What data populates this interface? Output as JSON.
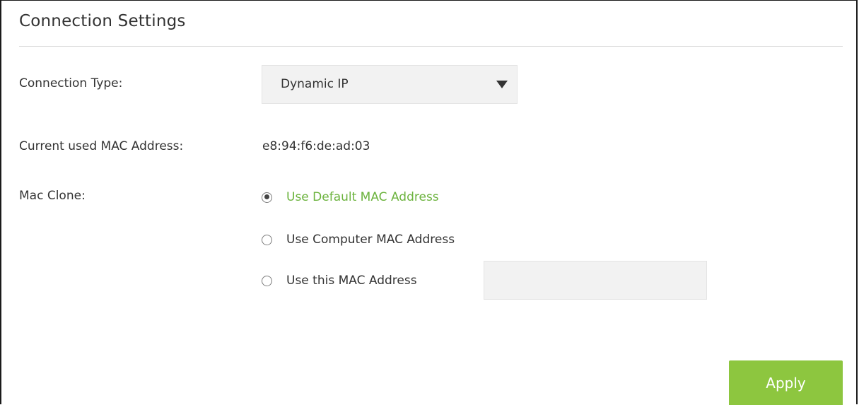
{
  "section": {
    "title": "Connection Settings"
  },
  "connection_type": {
    "label": "Connection Type:",
    "selected": "Dynamic IP"
  },
  "current_mac": {
    "label": "Current used MAC Address:",
    "value": "e8:94:f6:de:ad:03"
  },
  "mac_clone": {
    "label": "Mac Clone:",
    "options": [
      {
        "label": "Use Default MAC Address",
        "checked": true
      },
      {
        "label": "Use Computer MAC Address",
        "checked": false
      },
      {
        "label": "Use this MAC Address",
        "checked": false
      }
    ],
    "custom_mac_value": ""
  },
  "actions": {
    "apply_label": "Apply"
  },
  "colors": {
    "accent": "#8dc63f",
    "selected_text": "#6cb33e",
    "field_background": "#f2f2f2"
  },
  "icons": {
    "select_caret": "caret-down-icon",
    "radio": "radio-button-icon"
  }
}
